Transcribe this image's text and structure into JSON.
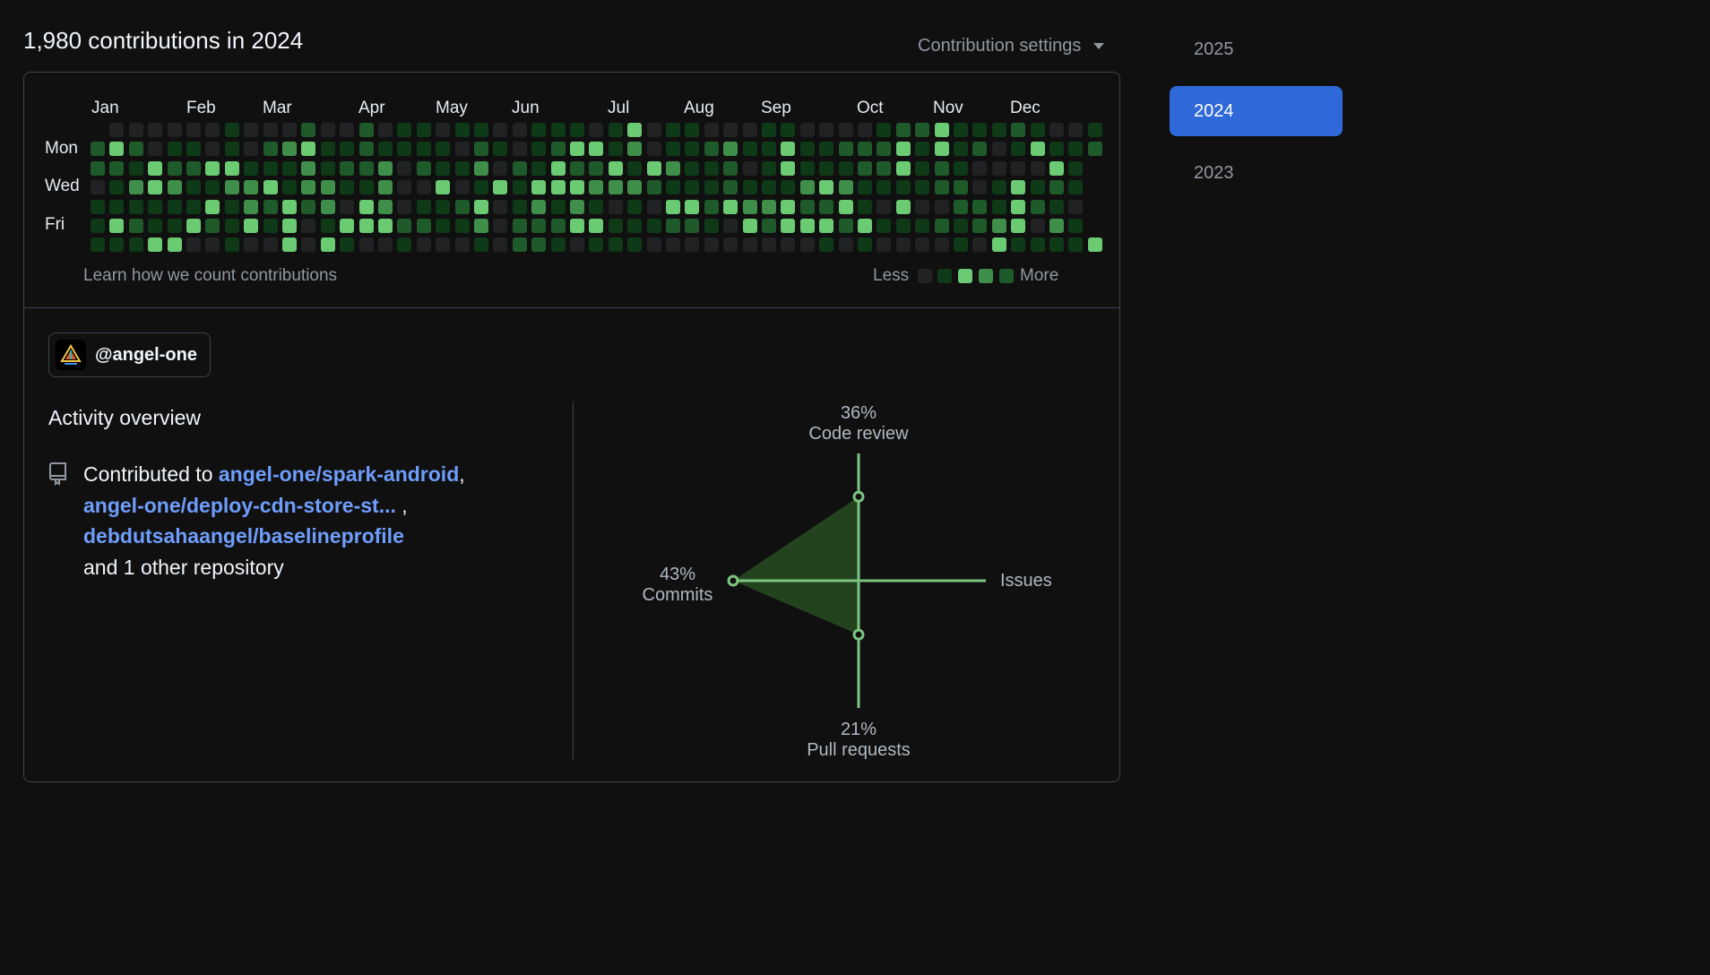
{
  "header": {
    "title": "1,980 contributions in 2024",
    "settings_label": "Contribution settings"
  },
  "calendar": {
    "months": [
      "Jan",
      "Feb",
      "Mar",
      "Apr",
      "May",
      "Jun",
      "Jul",
      "Aug",
      "Sep",
      "Oct",
      "Nov",
      "Dec"
    ],
    "days": [
      "Mon",
      "Wed",
      "Fri"
    ],
    "learn_link": "Learn how we count contributions",
    "legend_less": "Less",
    "legend_more": "More",
    "colors": [
      "#212224",
      "#0e3a17",
      "#1f5b2a",
      "#3f8f4a",
      "#6acb73"
    ]
  },
  "user": {
    "handle": "@angel-one",
    "avatar_icon": "angel-one-logo"
  },
  "activity": {
    "title": "Activity overview",
    "contributed_prefix": "Contributed to",
    "repos": [
      "angel-one/spark-android",
      "angel-one/deploy-cdn-store-st...",
      "debdutsahaangel/baselineprofile"
    ],
    "others": "and 1 other repository",
    "icon": "repo-icon"
  },
  "radar": {
    "code_review_pct": "36%",
    "code_review_label": "Code review",
    "commits_pct": "43%",
    "commits_label": "Commits",
    "issues_label": "Issues",
    "pull_requests_pct": "21%",
    "pull_requests_label": "Pull requests",
    "values": {
      "code_review": 36,
      "commits": 43,
      "issues": 0,
      "pull_requests": 21
    },
    "axis_color": "#7cc57f",
    "fill_color": "#23431f"
  },
  "years": [
    "2025",
    "2024",
    "2023"
  ],
  "selected_year": "2024"
}
